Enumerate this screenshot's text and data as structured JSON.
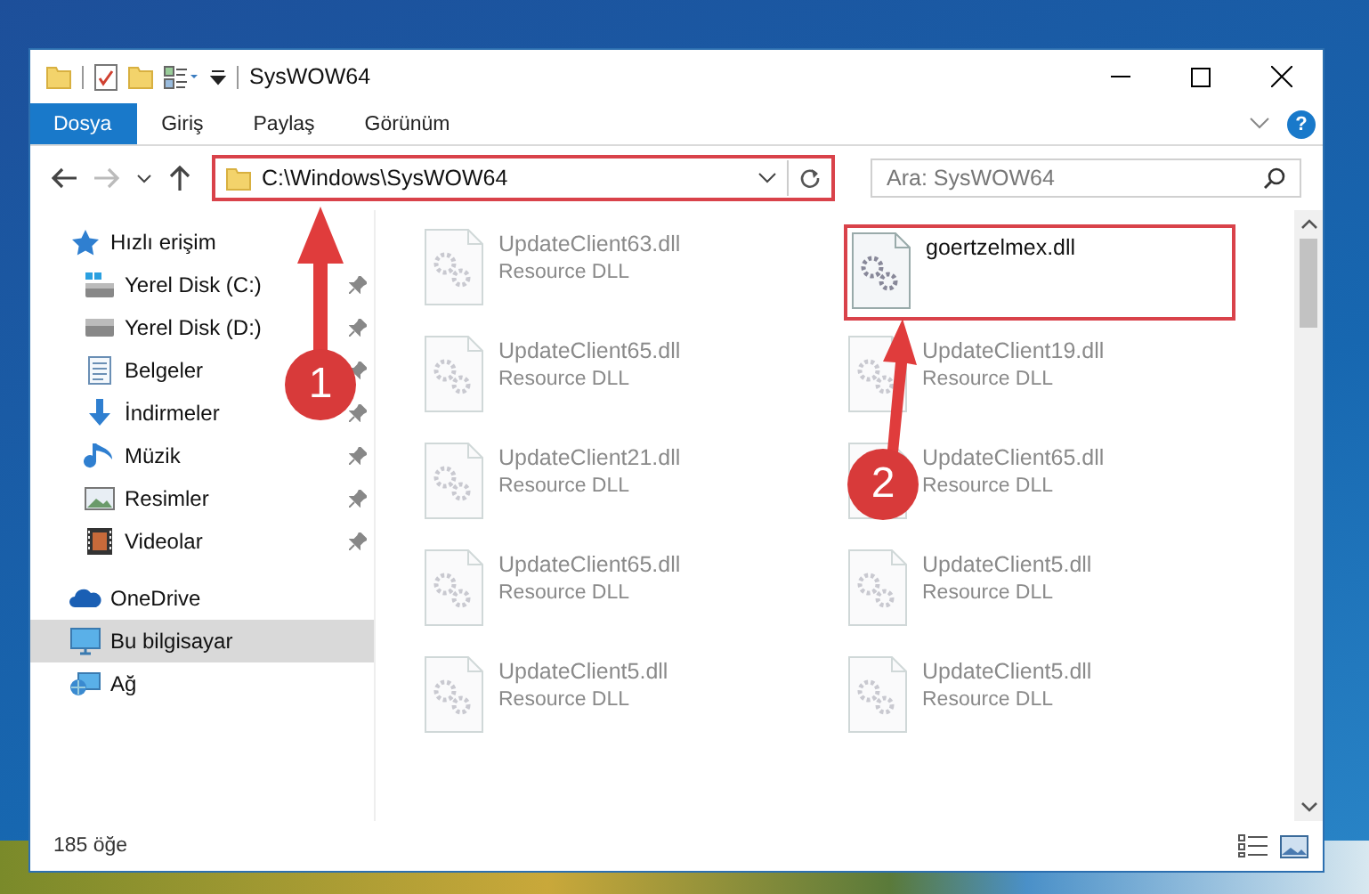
{
  "window": {
    "title": "SysWOW64",
    "help": "?"
  },
  "ribbon_tabs": [
    {
      "label": "Dosya",
      "selected": true
    },
    {
      "label": "Giriş",
      "selected": false
    },
    {
      "label": "Paylaş",
      "selected": false
    },
    {
      "label": "Görünüm",
      "selected": false
    }
  ],
  "address_bar": {
    "path": "C:\\Windows\\SysWOW64",
    "highlighted": true
  },
  "search": {
    "placeholder": "Ara: SysWOW64"
  },
  "sidebar": {
    "items": [
      {
        "label": "Hızlı erişim",
        "kind": "star",
        "selected": false,
        "children": [
          {
            "label": "Yerel Disk (C:)",
            "kind": "system-drive",
            "pinned": true,
            "selected": false
          },
          {
            "label": "Yerel Disk (D:)",
            "kind": "drive",
            "pinned": true,
            "selected": false
          },
          {
            "label": "Belgeler",
            "kind": "documents",
            "pinned": true,
            "selected": false
          },
          {
            "label": "İndirmeler",
            "kind": "download",
            "pinned": true,
            "selected": false
          },
          {
            "label": "Müzik",
            "kind": "music",
            "pinned": true,
            "selected": false
          },
          {
            "label": "Resimler",
            "kind": "pictures",
            "pinned": true,
            "selected": false
          },
          {
            "label": "Videolar",
            "kind": "videos",
            "pinned": true,
            "selected": false
          }
        ]
      },
      {
        "label": "OneDrive",
        "kind": "cloud",
        "selected": false
      },
      {
        "label": "Bu bilgisayar",
        "kind": "computer",
        "selected": true
      },
      {
        "label": "Ağ",
        "kind": "network",
        "selected": false
      }
    ]
  },
  "files": [
    {
      "name": "UpdateClient63.dll",
      "type": "Resource DLL",
      "faded": true,
      "highlighted": false
    },
    {
      "name": "goertzelmex.dll",
      "faded": false,
      "highlighted": true
    },
    {
      "name": "UpdateClient65.dll",
      "type": "Resource DLL",
      "faded": true,
      "highlighted": false
    },
    {
      "name": "UpdateClient19.dll",
      "type": "Resource DLL",
      "faded": true,
      "highlighted": false
    },
    {
      "name": "UpdateClient21.dll",
      "type": "Resource DLL",
      "faded": true,
      "highlighted": false
    },
    {
      "name": "UpdateClient65.dll",
      "type": "Resource DLL",
      "faded": true,
      "highlighted": false
    },
    {
      "name": "UpdateClient65.dll",
      "type": "Resource DLL",
      "faded": true,
      "highlighted": false
    },
    {
      "name": "UpdateClient5.dll",
      "type": "Resource DLL",
      "faded": true,
      "highlighted": false
    },
    {
      "name": "UpdateClient5.dll",
      "type": "Resource DLL",
      "faded": true,
      "highlighted": false
    },
    {
      "name": "UpdateClient5.dll",
      "type": "Resource DLL",
      "faded": true,
      "highlighted": false
    }
  ],
  "status_bar": {
    "item_count": "185 öğe"
  },
  "annotations": [
    {
      "label": "1"
    },
    {
      "label": "2"
    }
  ]
}
